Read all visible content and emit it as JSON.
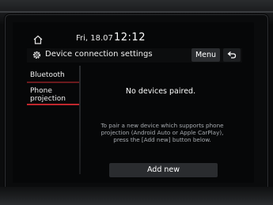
{
  "status_bar": {
    "date": "Fri, 18.07",
    "time": "12:12"
  },
  "title_bar": {
    "title": "Device connection settings",
    "menu_label": "Menu"
  },
  "sidebar": {
    "items": [
      {
        "label": "Bluetooth"
      },
      {
        "label": "Phone projection",
        "selected": true
      }
    ]
  },
  "main": {
    "message": "No devices paired.",
    "instructions": "To pair a new device which supports phone projection (Android Auto or Apple CarPlay), press the [Add new] button below.",
    "add_button_label": "Add new"
  },
  "colors": {
    "accent": "#c1272d",
    "background": "#060708",
    "button": "#2a2c2f"
  },
  "icons": {
    "home": "home-icon",
    "settings": "gear-icon",
    "back": "back-arrow-icon"
  }
}
